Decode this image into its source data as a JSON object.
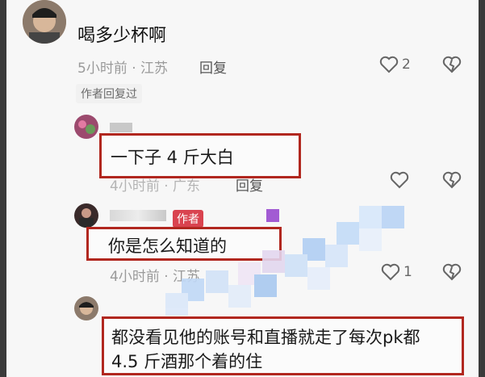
{
  "comments": [
    {
      "text": "喝多少杯啊",
      "meta": "5小时前 · 江苏",
      "reply_label": "回复",
      "likes": "2",
      "author_replied_badge": "作者回复过"
    },
    {
      "text": "一下子 4 斤大白",
      "meta": "4小时前 · 广东",
      "reply_label": "回复"
    },
    {
      "author_tag": "作者",
      "text": "你是怎么知道的",
      "meta": "4小时前 · 江苏",
      "likes": "1"
    },
    {
      "text_line1": "都没看见他的账号和直播就走了每次pk都",
      "text_line2": "4.5 斤酒那个着的住"
    }
  ],
  "colors": {
    "highlight_box": "#b1271f",
    "author_tag": "#d9434f",
    "meta_text": "#9a9a9a"
  },
  "icons": [
    "heart-icon",
    "dislike-heart-icon",
    "avatar"
  ]
}
